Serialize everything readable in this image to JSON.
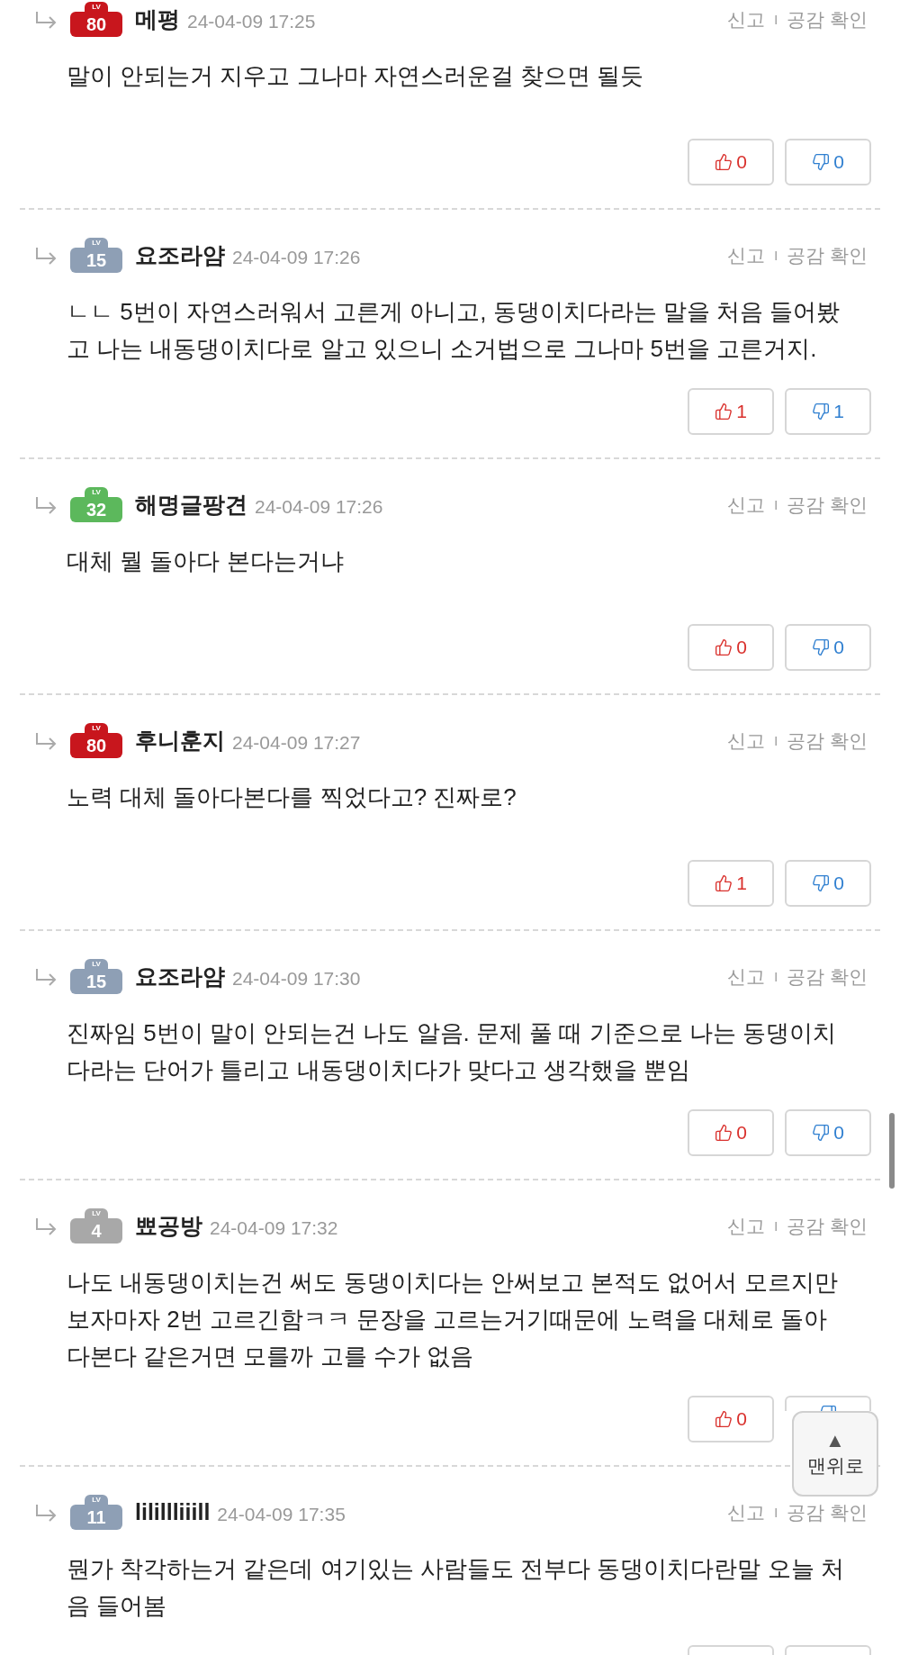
{
  "comments": [
    {
      "level": "80",
      "level_label": "LV",
      "color": "#c8161d",
      "author": "메평",
      "time": "24-04-09 17:25",
      "report": "신고",
      "separator": "I",
      "empathy": "공감 확인",
      "text": "말이 안되는거 지우고 그나마 자연스러운걸 찾으면 될듯",
      "likes": "0",
      "dislikes": "0"
    },
    {
      "level": "15",
      "level_label": "LV",
      "color": "#8e9fb5",
      "author": "요조라얌",
      "time": "24-04-09 17:26",
      "report": "신고",
      "separator": "I",
      "empathy": "공감 확인",
      "text": "ㄴㄴ 5번이 자연스러워서 고른게 아니고, 동댕이치다라는 말을 처음 들어봤고 나는 내동댕이치다로 알고 있으니 소거법으로 그나마 5번을 고른거지.",
      "likes": "1",
      "dislikes": "1"
    },
    {
      "level": "32",
      "level_label": "LV",
      "color": "#5cb85c",
      "author": "해명글팡견",
      "time": "24-04-09 17:26",
      "report": "신고",
      "separator": "I",
      "empathy": "공감 확인",
      "text": "대체 뭘 돌아다 본다는거냐",
      "likes": "0",
      "dislikes": "0"
    },
    {
      "level": "80",
      "level_label": "LV",
      "color": "#c8161d",
      "author": "후니훈지",
      "time": "24-04-09 17:27",
      "report": "신고",
      "separator": "I",
      "empathy": "공감 확인",
      "text": "노력 대체 돌아다본다를 찍었다고? 진짜로?",
      "likes": "1",
      "dislikes": "0"
    },
    {
      "level": "15",
      "level_label": "LV",
      "color": "#8e9fb5",
      "author": "요조라얌",
      "time": "24-04-09 17:30",
      "report": "신고",
      "separator": "I",
      "empathy": "공감 확인",
      "text": "진짜임 5번이 말이 안되는건 나도 알음. 문제 풀 때 기준으로 나는 동댕이치다라는 단어가 틀리고 내동댕이치다가 맞다고 생각했을 뿐임",
      "likes": "0",
      "dislikes": "0"
    },
    {
      "level": "4",
      "level_label": "LV",
      "color": "#a8a8a8",
      "author": "뾰공방",
      "time": "24-04-09 17:32",
      "report": "신고",
      "separator": "I",
      "empathy": "공감 확인",
      "text": "나도 내동댕이치는건 써도 동댕이치다는 안써보고 본적도 없어서 모르지만 보자마자 2번 고르긴함ㅋㅋ 문장을 고르는거기때문에 노력을 대체로 돌아다본다 같은거면 모를까 고를 수가 없음",
      "likes": "0"
    },
    {
      "level": "11",
      "level_label": "LV",
      "color": "#8e9fb5",
      "author": "lilillliiill",
      "time": "24-04-09 17:35",
      "report": "신고",
      "separator": "I",
      "empathy": "공감 확인",
      "text": "뭔가 착각하는거 같은데 여기있는 사람들도 전부다 동댕이치다란말 오늘 처음 들어봄"
    }
  ],
  "to_top": {
    "arrow": "▲",
    "label": "맨위로"
  }
}
